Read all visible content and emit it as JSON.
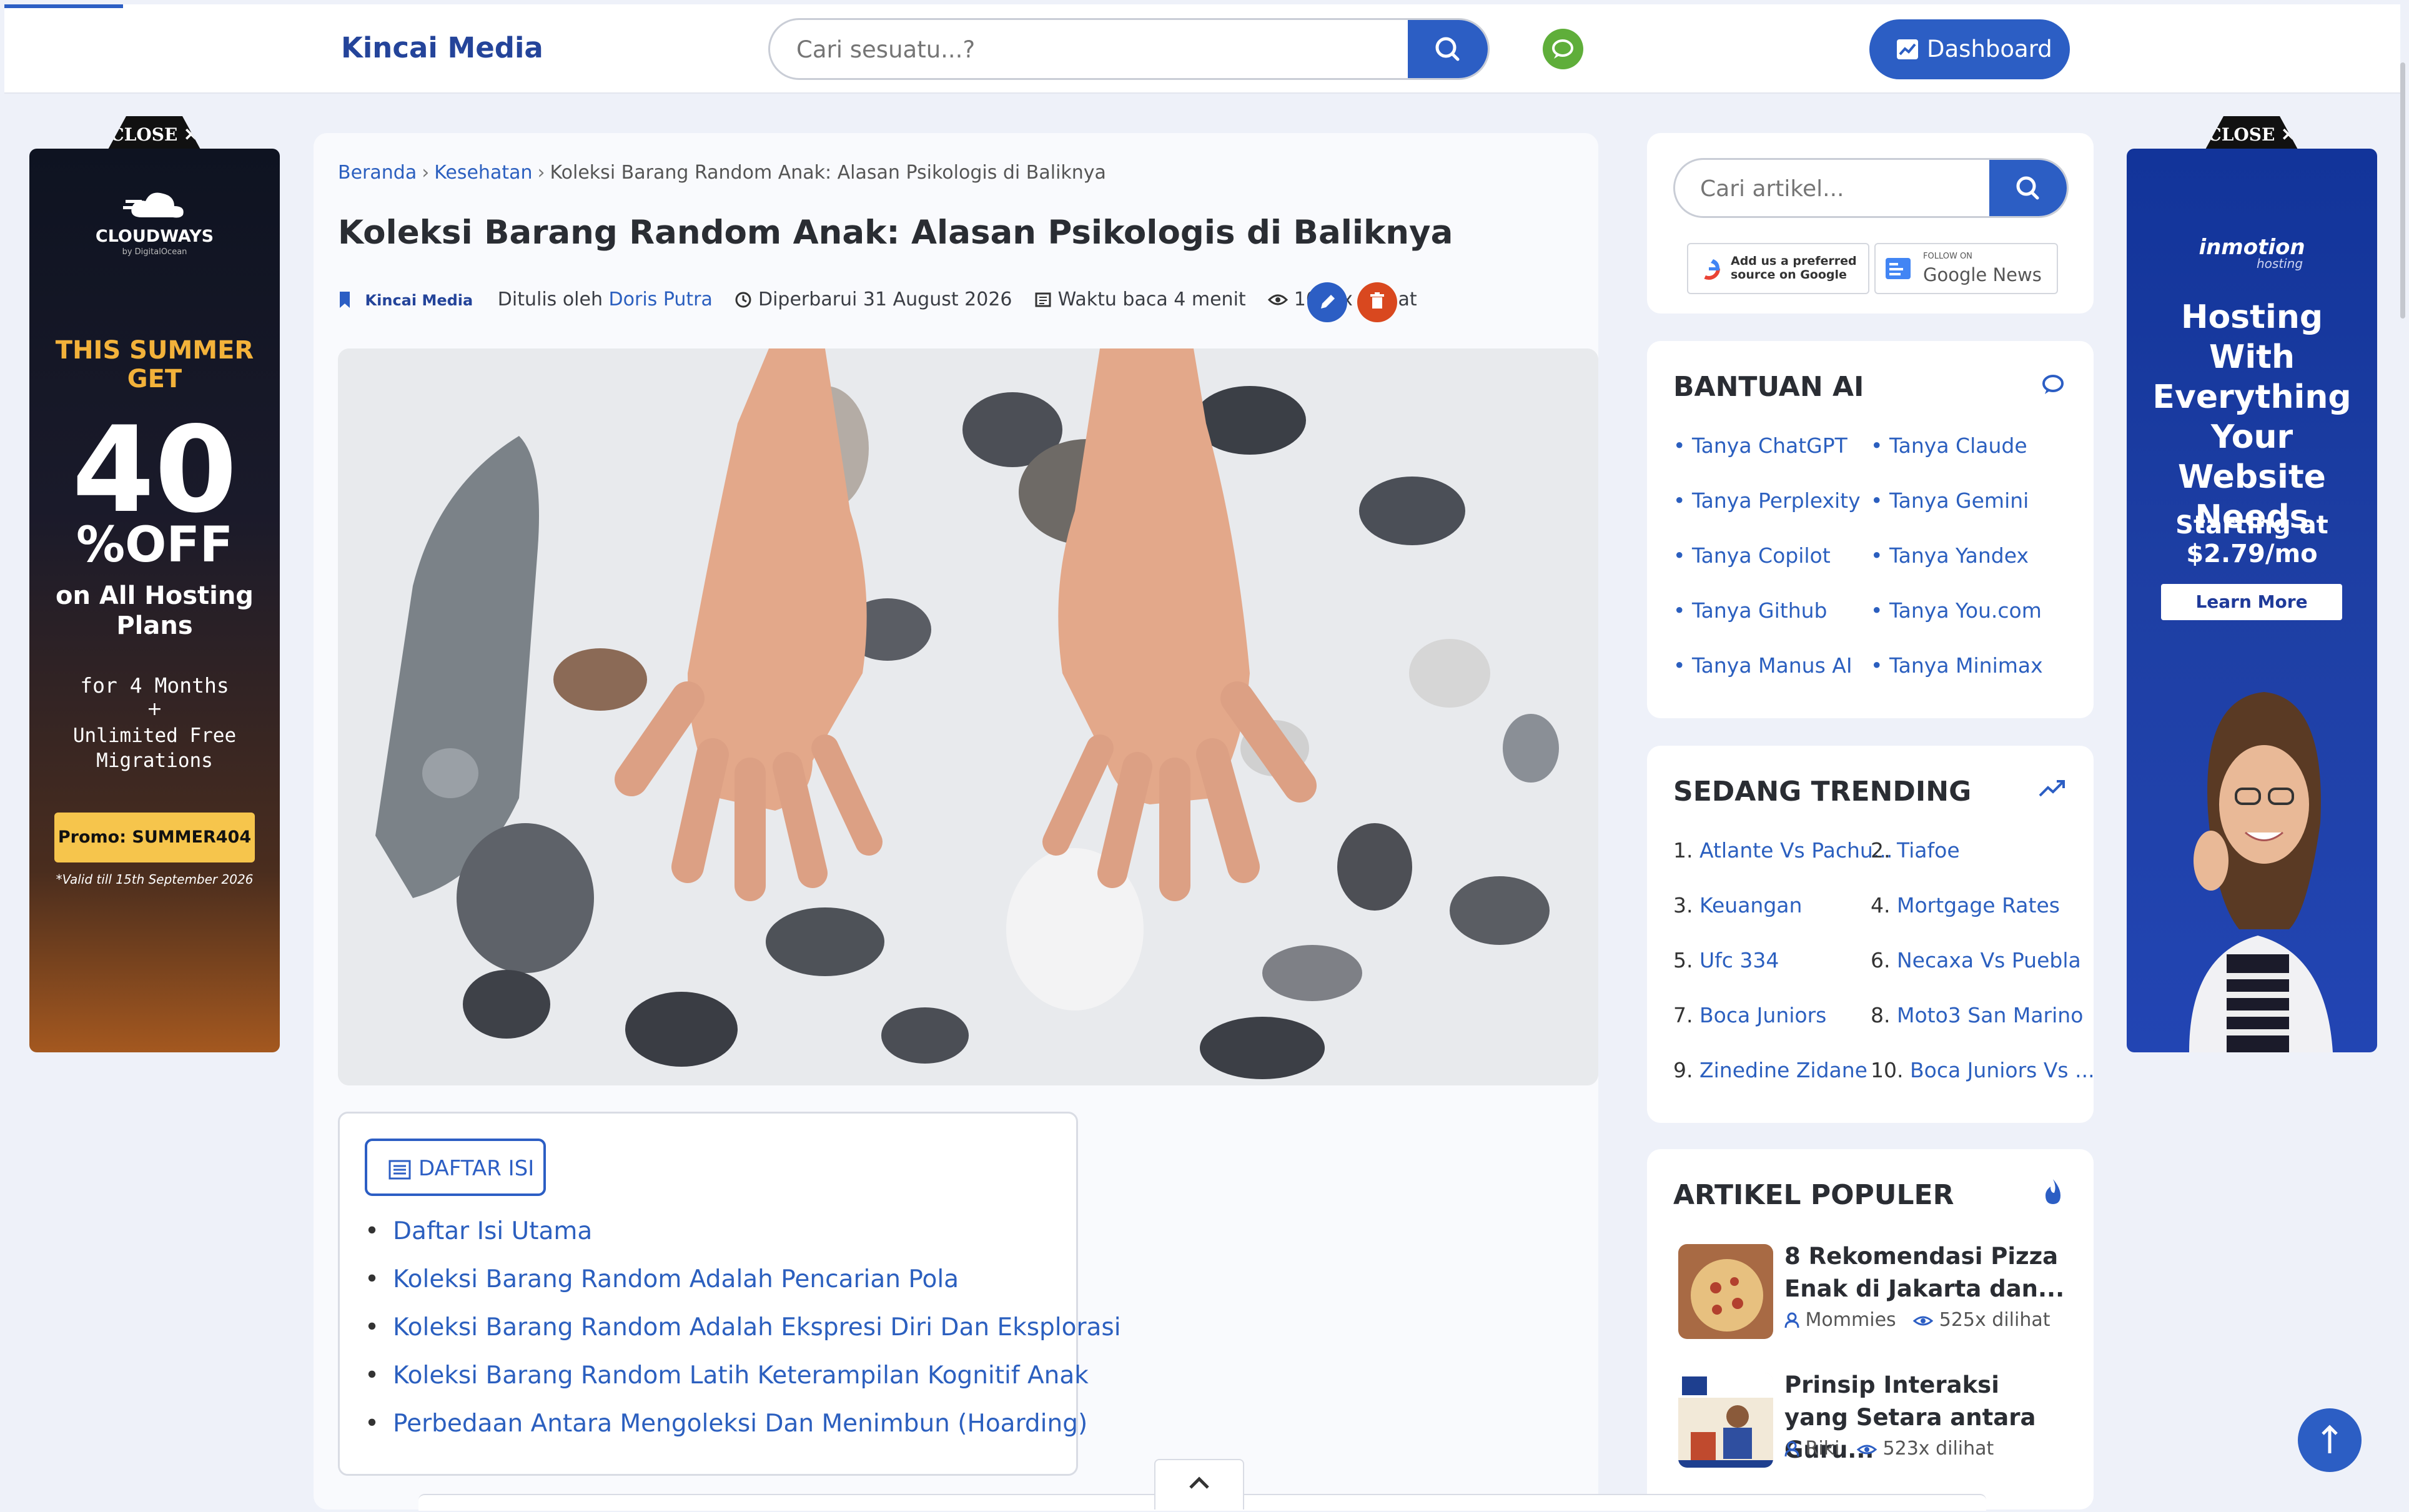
{
  "header": {
    "brand": "Kincai Media",
    "search_placeholder": "Cari sesuatu...?",
    "dashboard_label": "Dashboard"
  },
  "ads": {
    "close_label": "CLOSE",
    "left": {
      "brand": "CLOUDWAYS",
      "brand_sub": "by DigitalOcean",
      "headline": "THIS SUMMER GET",
      "big": "40",
      "off": "%OFF",
      "plans": "on All Hosting Plans",
      "months": "for 4 Months",
      "plus": "+",
      "migrations": "Unlimited Free Migrations",
      "promo": "Promo: SUMMER404",
      "valid": "*Valid till 15th September 2026"
    },
    "right": {
      "brand": "inmotion",
      "brand_sub": "hosting",
      "headline": "Hosting With Everything Your Website Needs",
      "price": "Starting at $2.79/mo",
      "cta": "Learn More"
    }
  },
  "article": {
    "breadcrumb": [
      "Beranda",
      "Kesehatan",
      "Koleksi Barang Random Anak: Alasan Psikologis di Baliknya"
    ],
    "title": "Koleksi Barang Random Anak: Alasan Psikologis di Baliknya",
    "meta": {
      "site": "Kincai Media",
      "written_by": "Ditulis oleh",
      "author": "Doris Putra",
      "updated": "Diperbarui 31 August 2026",
      "read_time": "Waktu baca 4 menit",
      "views": "1029x dilihat"
    },
    "toc": {
      "label": "DAFTAR ISI",
      "items": [
        "Daftar Isi Utama",
        "Koleksi Barang Random Adalah Pencarian Pola",
        "Koleksi Barang Random Adalah Ekspresi Diri Dan Eksplorasi",
        "Koleksi Barang Random Latih Keterampilan Kognitif Anak",
        "Perbedaan Antara Mengoleksi Dan Menimbun (Hoarding)"
      ]
    }
  },
  "sidebar": {
    "search_placeholder": "Cari artikel...",
    "badges": {
      "google_pref_line1": "Add us a preferred",
      "google_pref_line2": "source on Google",
      "gnews_small": "FOLLOW ON",
      "gnews_label": "Google News"
    },
    "ai": {
      "title": "BANTUAN AI",
      "items": [
        "Tanya ChatGPT",
        "Tanya Claude",
        "Tanya Perplexity",
        "Tanya Gemini",
        "Tanya Copilot",
        "Tanya Yandex",
        "Tanya Github",
        "Tanya You.com",
        "Tanya Manus AI",
        "Tanya Minimax"
      ]
    },
    "trending": {
      "title": "SEDANG TRENDING",
      "items": [
        {
          "num": "1.",
          "label": "Atlante Vs Pachu..."
        },
        {
          "num": "2.",
          "label": "Tiafoe"
        },
        {
          "num": "3.",
          "label": "Keuangan"
        },
        {
          "num": "4.",
          "label": "Mortgage Rates"
        },
        {
          "num": "5.",
          "label": "Ufc 334"
        },
        {
          "num": "6.",
          "label": "Necaxa Vs Puebla"
        },
        {
          "num": "7.",
          "label": "Boca Juniors"
        },
        {
          "num": "8.",
          "label": "Moto3 San Marino"
        },
        {
          "num": "9.",
          "label": "Zinedine Zidane"
        },
        {
          "num": "10.",
          "label": "Boca Juniors Vs ..."
        }
      ]
    },
    "popular": {
      "title": "ARTIKEL POPULER",
      "items": [
        {
          "title": "8 Rekomendasi Pizza Enak di Jakarta dan...",
          "author": "Mommies",
          "views": "525x dilihat"
        },
        {
          "title": "Prinsip Interaksi yang Setara antara Guru...",
          "author": "Riki",
          "views": "523x dilihat"
        }
      ]
    }
  },
  "colors": {
    "primary": "#2c5ec4",
    "brand_text": "#24449a",
    "chat": "#5fae3a",
    "delete": "#d9481f"
  }
}
